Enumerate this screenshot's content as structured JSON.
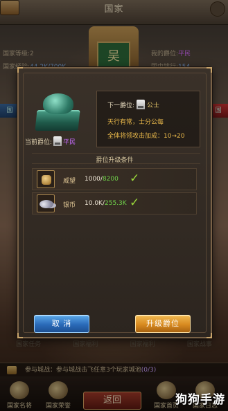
{
  "header": {
    "title": "国家"
  },
  "kingdom": {
    "level_label": "国家等级:",
    "level_value": "2",
    "exp_label": "国家经验:",
    "exp_value": "44.2K/700K",
    "my_rank_label": "我的爵位:",
    "my_rank_value": "平民",
    "domestic_rank_label": "国内排行:",
    "domestic_rank_value": "154",
    "banner_char": "吴"
  },
  "side_chips": {
    "left": "国",
    "right": "国"
  },
  "modal": {
    "current_rank_label": "当前爵位:",
    "current_rank": "平民",
    "next_rank_label": "下一爵位:",
    "next_rank": "公士",
    "desc": "天行有常，士分公每",
    "bonus": "全体将领攻击加成：10→20",
    "conditions_title": "爵位升级条件",
    "conditions": [
      {
        "icon": "prestige-icon",
        "label": "威望",
        "current": "1000",
        "required": "8200",
        "met": "✓"
      },
      {
        "icon": "silver-coin-icon",
        "label": "银币",
        "current": "10.0K",
        "required": "255.3K",
        "met": "✓"
      }
    ],
    "cancel_label": "取 消",
    "upgrade_label": "升级爵位"
  },
  "background_labels": [
    "国家任务",
    "国家福利",
    "国家福利",
    "国家战事"
  ],
  "battle": {
    "prefix": "参与城战：参与城战击飞任意3个玩家城池",
    "count": "(0/3)"
  },
  "bottom_nav": {
    "items": [
      {
        "label": "国家名将"
      },
      {
        "label": "国家荣誉"
      },
      {
        "label": "国家首页"
      },
      {
        "label": "国家日志"
      }
    ],
    "back_label": "返回"
  },
  "watermark": "狗狗手游"
}
